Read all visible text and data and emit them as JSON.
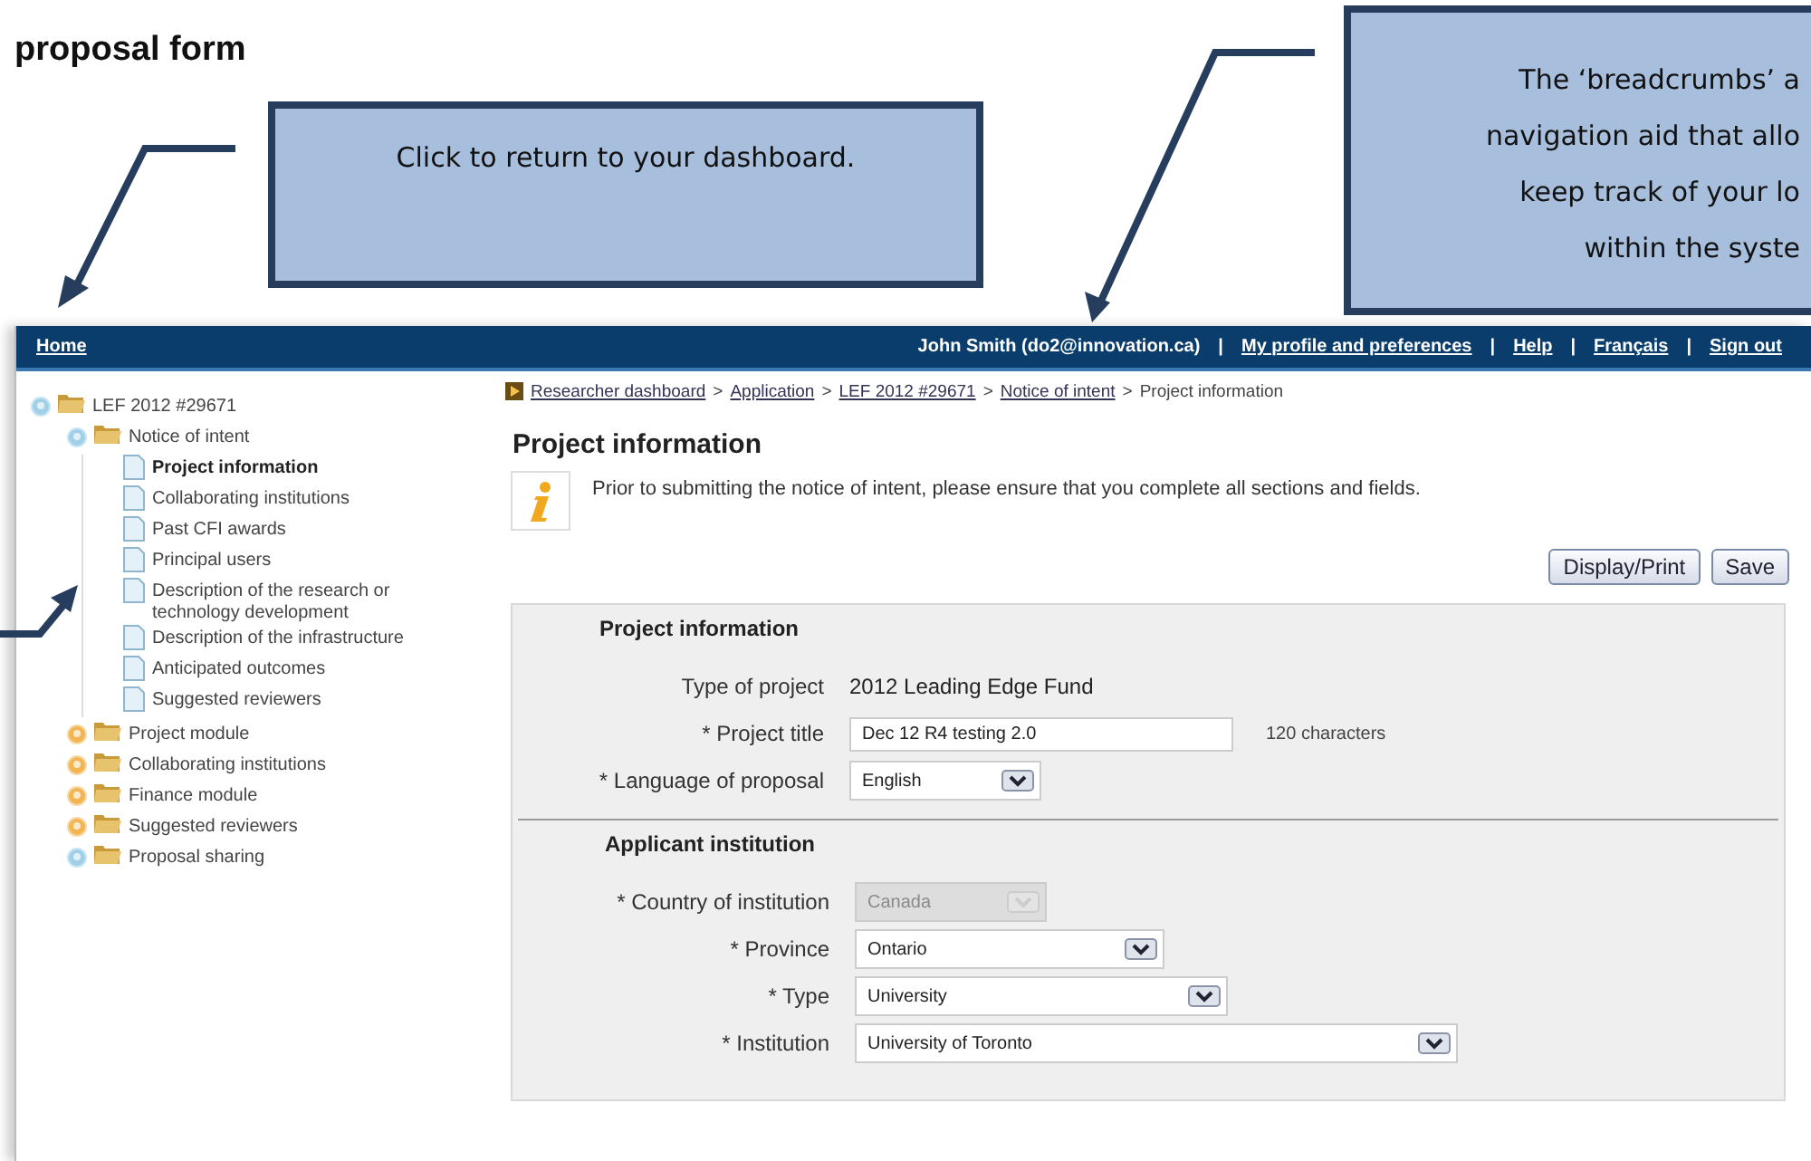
{
  "heading": "proposal form",
  "callouts": [
    {
      "lines": [
        "Click to return to your dashboard."
      ]
    },
    {
      "lines": [
        "The ‘breadcrumbs’ a",
        "navigation aid that allo",
        "keep track of your lo",
        "within the syste"
      ]
    }
  ],
  "top_bar": {
    "home": "Home",
    "user": "John Smith (do2@innovation.ca)",
    "separator": "|",
    "links": [
      "My profile and preferences",
      "Help",
      "Français",
      "Sign out"
    ]
  },
  "tree": [
    {
      "label": "LEF 2012 #29671",
      "kind": "folder",
      "expanded": true,
      "selected": false,
      "children": [
        {
          "label": "Notice of intent",
          "kind": "folder",
          "expanded": true,
          "selected": false,
          "children": [
            {
              "label": "Project information",
              "kind": "page",
              "selected": true
            },
            {
              "label": "Collaborating institutions",
              "kind": "page",
              "selected": false
            },
            {
              "label": "Past CFI awards",
              "kind": "page",
              "selected": false
            },
            {
              "label": "Principal users",
              "kind": "page",
              "selected": false
            },
            {
              "label": "Description of the research or technology development",
              "kind": "page",
              "selected": false
            },
            {
              "label": "Description of the infrastructure",
              "kind": "page",
              "selected": false
            },
            {
              "label": "Anticipated outcomes",
              "kind": "page",
              "selected": false
            },
            {
              "label": "Suggested reviewers",
              "kind": "page",
              "selected": false
            }
          ]
        },
        {
          "label": "Project module",
          "kind": "folder",
          "expanded": false,
          "selected": false
        },
        {
          "label": "Collaborating institutions",
          "kind": "folder",
          "expanded": false,
          "selected": false
        },
        {
          "label": "Finance module",
          "kind": "folder",
          "expanded": false,
          "selected": false
        },
        {
          "label": "Suggested reviewers",
          "kind": "folder",
          "expanded": false,
          "selected": false
        },
        {
          "label": "Proposal sharing",
          "kind": "folder",
          "expanded": true,
          "selected": false
        }
      ]
    }
  ],
  "breadcrumbs": {
    "separator": ">",
    "items": [
      {
        "label": "Researcher dashboard",
        "link": true
      },
      {
        "label": "Application",
        "link": true
      },
      {
        "label": "LEF 2012 #29671",
        "link": true
      },
      {
        "label": "Notice of intent",
        "link": true
      },
      {
        "label": "Project information",
        "link": false
      }
    ]
  },
  "page_title": "Project information",
  "notice": "Prior to submitting the notice of intent, please ensure that you complete all sections and fields.",
  "buttons": [
    "Display/Print",
    "Save"
  ],
  "sections": [
    {
      "title": "Project information",
      "rows": [
        {
          "label": "Type of project",
          "kind": "static",
          "value": "2012 Leading Edge Fund"
        },
        {
          "label": "* Project title",
          "kind": "text",
          "value": "Dec 12 R4 testing 2.0",
          "hint": "120   characters"
        },
        {
          "label": "* Language of proposal",
          "kind": "select",
          "value": "English",
          "disabled": false
        }
      ]
    },
    {
      "title": "Applicant institution",
      "rows": [
        {
          "label": "* Country of institution",
          "kind": "select",
          "value": "Canada",
          "disabled": true
        },
        {
          "label": "* Province",
          "kind": "select",
          "value": "Ontario",
          "disabled": false
        },
        {
          "label": "* Type",
          "kind": "select",
          "value": "University",
          "disabled": false
        },
        {
          "label": "* Institution",
          "kind": "select",
          "value": "University of Toronto",
          "disabled": false
        }
      ]
    }
  ]
}
